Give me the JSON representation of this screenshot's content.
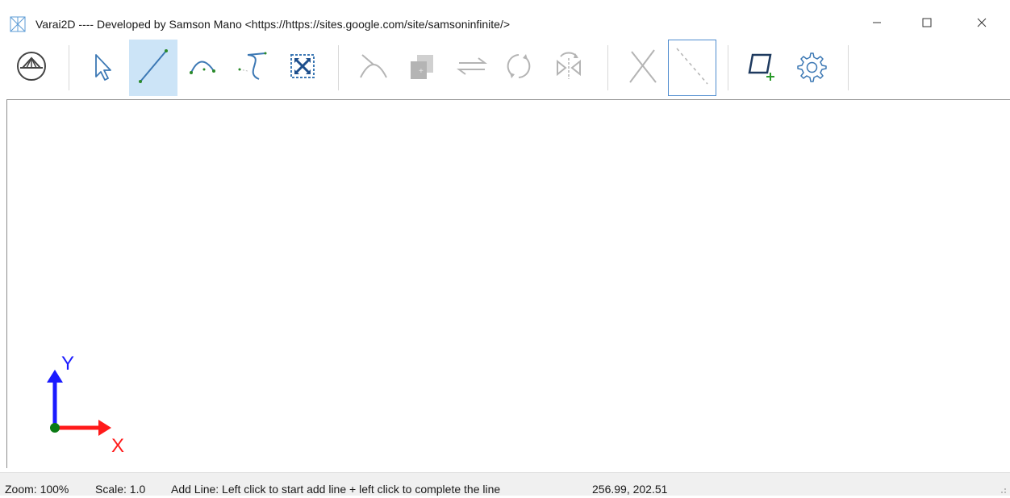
{
  "window": {
    "title": "Varai2D ---- Developed by Samson Mano <https://https://sites.google.com/site/samsoninfinite/>",
    "icon": "varai2d-app-icon"
  },
  "window_controls": [
    {
      "name": "minimize-button",
      "icon": "minimize-icon"
    },
    {
      "name": "maximize-button",
      "icon": "maximize-icon"
    },
    {
      "name": "close-button",
      "icon": "close-icon"
    }
  ],
  "toolbar": {
    "buttons": [
      {
        "name": "home-view-button",
        "icon": "truss-logo-icon",
        "state": "normal"
      },
      {
        "name": "select-tool-button",
        "icon": "pointer-icon",
        "state": "normal"
      },
      {
        "name": "add-line-button",
        "icon": "line-icon",
        "state": "active"
      },
      {
        "name": "add-arc-button",
        "icon": "arc-icon",
        "state": "normal"
      },
      {
        "name": "add-curve-button",
        "icon": "curve-icon",
        "state": "normal"
      },
      {
        "name": "zoom-fit-button",
        "icon": "zoom-fit-icon",
        "state": "normal"
      },
      {
        "name": "trim-button",
        "icon": "trim-icon",
        "state": "disabled"
      },
      {
        "name": "copy-button",
        "icon": "copy-icon",
        "state": "disabled"
      },
      {
        "name": "move-button",
        "icon": "move-icon",
        "state": "disabled"
      },
      {
        "name": "rotate-button",
        "icon": "rotate-icon",
        "state": "disabled"
      },
      {
        "name": "mirror-button",
        "icon": "mirror-icon",
        "state": "disabled"
      },
      {
        "name": "intersect-button",
        "icon": "intersect-icon",
        "state": "disabled"
      },
      {
        "name": "construction-line-button",
        "icon": "construction-line-icon",
        "state": "focused"
      },
      {
        "name": "add-surface-button",
        "icon": "add-surface-icon",
        "state": "normal"
      },
      {
        "name": "settings-button",
        "icon": "gear-icon",
        "state": "normal"
      }
    ]
  },
  "canvas": {
    "axis_x_label": "X",
    "axis_y_label": "Y",
    "colors": {
      "x_axis": "#ff1a1a",
      "y_axis": "#1a1aff",
      "origin": "#0a7a14"
    }
  },
  "status": {
    "zoom": "Zoom: 100%",
    "scale": "Scale: 1.0",
    "message": "Add Line: Left click to start add line + left click to complete the line",
    "coordinates": "256.99, 202.51"
  },
  "colors": {
    "active_button": "#cce4f7",
    "focus_border": "#4f8ccf",
    "icon_normal": "#3c78b4",
    "icon_disabled": "#b4b4b4"
  }
}
